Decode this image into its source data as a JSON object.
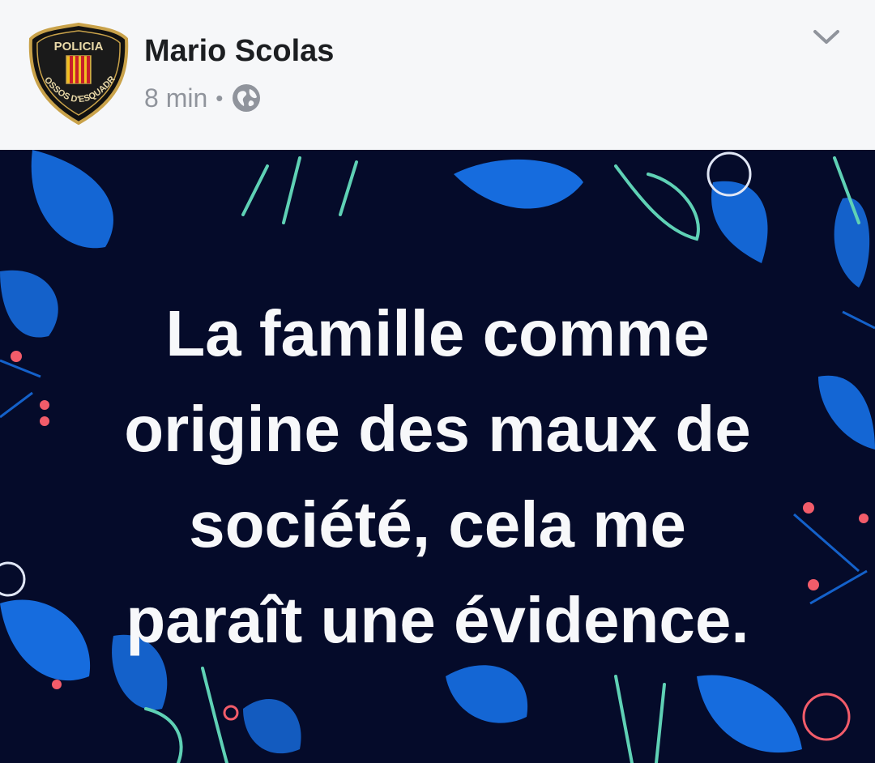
{
  "post": {
    "author_name": "Mario Scolas",
    "timestamp": "8 min",
    "separator": "•",
    "privacy_icon": "globe-icon",
    "menu_icon": "chevron-down-icon",
    "avatar": {
      "icon": "police-badge-avatar",
      "top_text": "POLICIA",
      "arc_text": "MOSSOS D'ESQUADRA"
    },
    "text_lines": [
      "La famille comme",
      "origine des maux de",
      "société, cela me",
      "paraît une évidence."
    ],
    "background_style": "navy-floral"
  },
  "colors": {
    "header_bg": "#f6f7f9",
    "author_text": "#1c1e21",
    "meta_text": "#90949c",
    "card_bg": "#050b2a",
    "card_text": "#f7f8fa",
    "leaf_blue": "#1877f2",
    "leaf_teal": "#5fd1b5",
    "berry_red": "#f25c6a"
  }
}
